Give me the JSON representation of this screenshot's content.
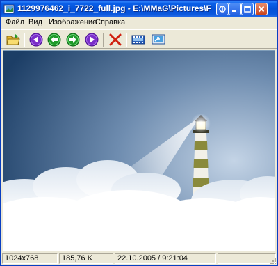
{
  "window": {
    "title": "1129976462_i_7722_full.jpg - E:\\MMaG\\Pictures\\F",
    "controls": [
      "restore-icon",
      "minimize-icon",
      "maximize-icon",
      "close-icon"
    ]
  },
  "menu": {
    "items": [
      {
        "label": "Файл"
      },
      {
        "label": "Вид"
      },
      {
        "label": "Изображение"
      },
      {
        "label": "Справка"
      }
    ]
  },
  "toolbar": {
    "buttons": [
      {
        "name": "open-folder",
        "icon": "folder-open-icon",
        "color": "#f0c848"
      },
      {
        "name": "first-image",
        "icon": "skip-back-icon",
        "color": "#7a2fc9"
      },
      {
        "name": "previous-image",
        "icon": "arrow-left-icon",
        "color": "#1f9a2a"
      },
      {
        "name": "next-image",
        "icon": "arrow-right-icon",
        "color": "#1f9a2a"
      },
      {
        "name": "last-image",
        "icon": "skip-forward-icon",
        "color": "#7a2fc9"
      },
      {
        "name": "delete",
        "icon": "delete-x-icon",
        "color": "#d02010"
      },
      {
        "name": "slideshow",
        "icon": "filmstrip-icon",
        "color": "#2a5fb8"
      },
      {
        "name": "set-wallpaper",
        "icon": "desktop-arrow-icon",
        "color": "#2a7fc8"
      }
    ]
  },
  "image": {
    "subject": "lighthouse-above-clouds",
    "sky_color": "#1c3e66",
    "cloud_color": "#ffffff"
  },
  "status": {
    "dimensions": "1024x768",
    "file_size": "185,76 K",
    "datetime": "22.10.2005 / 9:21:04"
  }
}
